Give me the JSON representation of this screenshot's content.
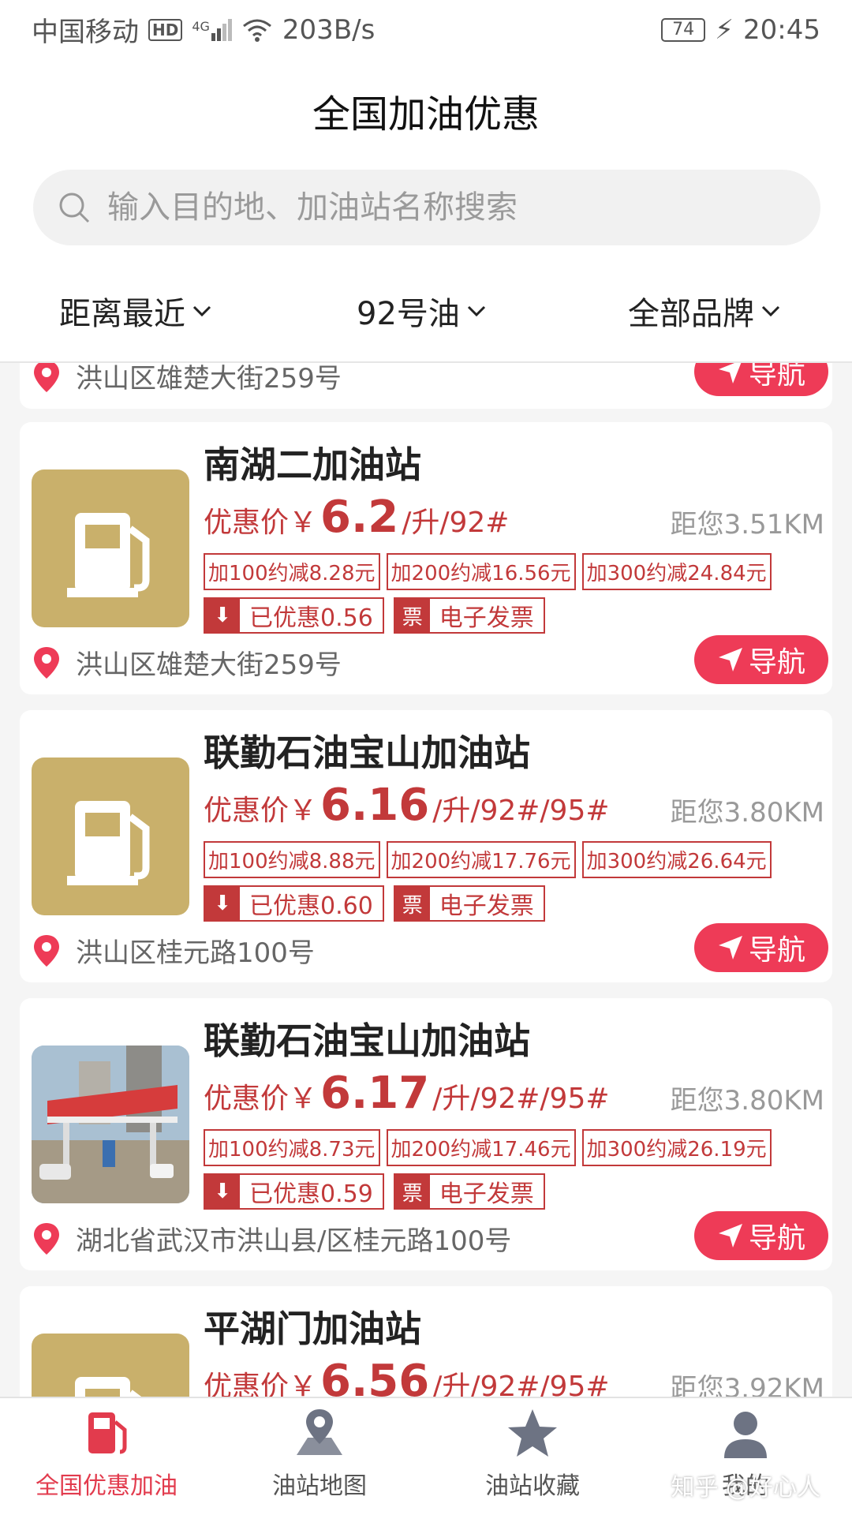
{
  "status_bar": {
    "carrier": "中国移动",
    "hd": "HD",
    "network": "4G",
    "speed": "203B/s",
    "battery": "74",
    "time": "20:45"
  },
  "header": {
    "title": "全国加油优惠"
  },
  "search": {
    "placeholder": "输入目的地、加油站名称搜索"
  },
  "filters": [
    {
      "label": "距离最近"
    },
    {
      "label": "92号油"
    },
    {
      "label": "全部品牌"
    }
  ],
  "nav_label": "导航",
  "price_prefix": "优惠价￥",
  "invoice_icon": "票",
  "partial_top": {
    "address": "洪山区雄楚大街259号"
  },
  "stations": [
    {
      "name": "南湖二加油站",
      "price": "6.2",
      "unit": "/升/92#",
      "distance": "距您3.51KM",
      "discounts": [
        "加100约减8.28元",
        "加200约减16.56元",
        "加300约减24.84元"
      ],
      "saved": "已优惠0.56",
      "invoice": "电子发票",
      "address": "洪山区雄楚大街259号",
      "thumb": "fuel-pump-icon"
    },
    {
      "name": "联勤石油宝山加油站",
      "price": "6.16",
      "unit": "/升/92#/95#",
      "distance": "距您3.80KM",
      "discounts": [
        "加100约减8.88元",
        "加200约减17.76元",
        "加300约减26.64元"
      ],
      "saved": "已优惠0.60",
      "invoice": "电子发票",
      "address": "洪山区桂元路100号",
      "thumb": "fuel-pump-icon"
    },
    {
      "name": "联勤石油宝山加油站",
      "price": "6.17",
      "unit": "/升/92#/95#",
      "distance": "距您3.80KM",
      "discounts": [
        "加100约减8.73元",
        "加200约减17.46元",
        "加300约减26.19元"
      ],
      "saved": "已优惠0.59",
      "invoice": "电子发票",
      "address": "湖北省武汉市洪山县/区桂元路100号",
      "thumb": "station-photo"
    },
    {
      "name": "平湖门加油站",
      "price": "6.56",
      "unit": "/升/92#/95#",
      "distance": "距您3.92KM",
      "thumb": "fuel-pump-icon"
    }
  ],
  "tabs": [
    {
      "label": "全国优惠加油",
      "active": true
    },
    {
      "label": "油站地图"
    },
    {
      "label": "油站收藏"
    },
    {
      "label": "我的"
    }
  ],
  "watermark": "知乎 @好心人",
  "colors": {
    "accent": "#c2393a",
    "nav": "#ee3b57",
    "thumb": "#c9b06b",
    "tab_active": "#e23b4d"
  }
}
